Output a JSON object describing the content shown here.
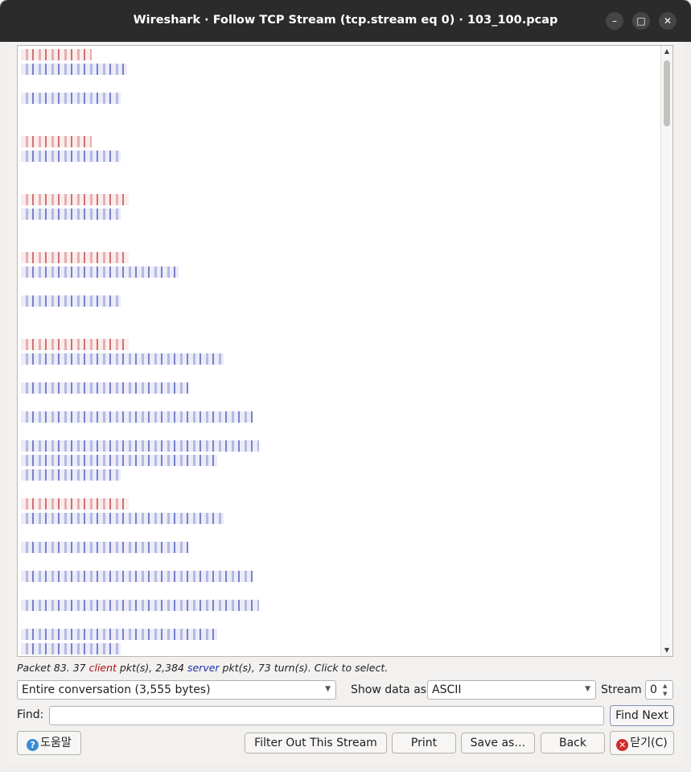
{
  "window": {
    "title": "Wireshark · Follow TCP Stream (tcp.stream eq 0) · 103_100.pcap",
    "controls": {
      "minimize": "–",
      "maximize": "□",
      "close": "✕"
    }
  },
  "stream_text": {
    "obscured": true,
    "client_color": "#b01010",
    "server_color": "#1b2fa5"
  },
  "status": {
    "part1": "Packet 83. 37 ",
    "client": "client",
    "part2": " pkt(s), 2,384 ",
    "server": "server",
    "part3": " pkt(s), 73 turn(s). Click to select."
  },
  "controls": {
    "conversation": "Entire conversation (3,555 bytes)",
    "show_data_as_label": "Show data as",
    "show_data_as_value": "ASCII",
    "stream_label": "Stream",
    "stream_value": "0",
    "find_label": "Find:",
    "find_value": "",
    "find_next": "Find Next"
  },
  "buttons": {
    "help": "도움말",
    "filter_out": "Filter Out This Stream",
    "print": "Print",
    "save_as": "Save as…",
    "back": "Back",
    "close": "닫기(C)"
  }
}
